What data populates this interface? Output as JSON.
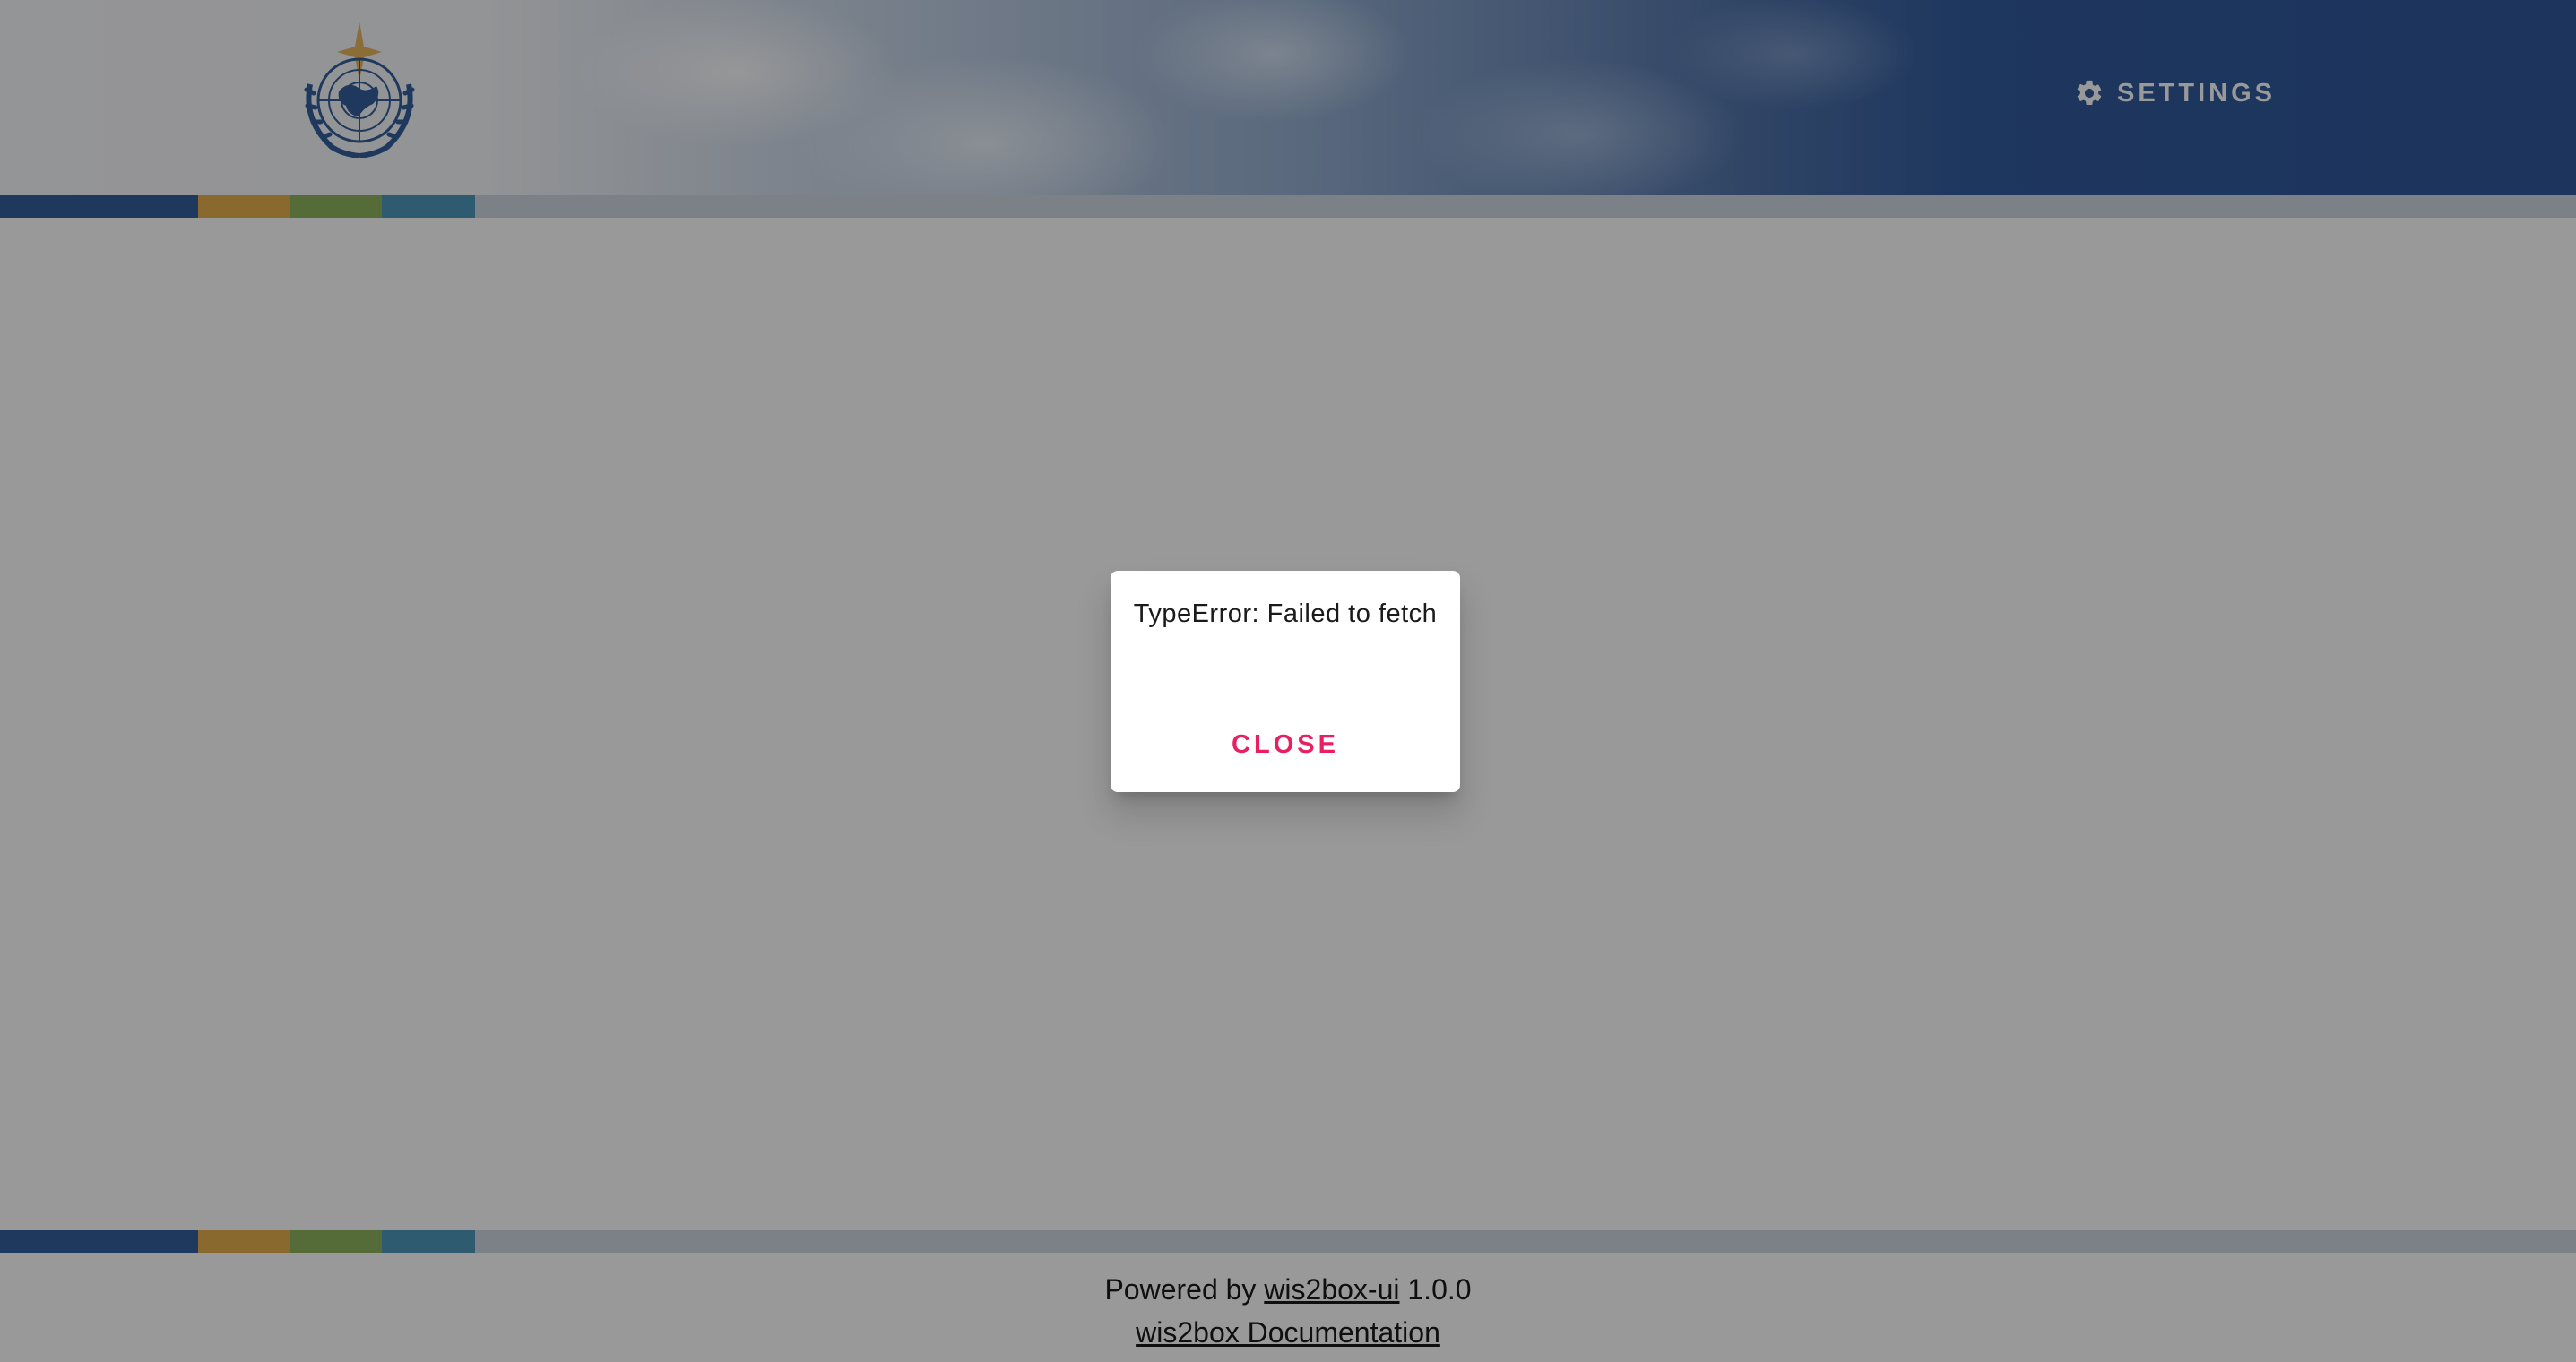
{
  "header": {
    "logo_icon": "wmo-emblem-icon",
    "settings_icon": "gear-icon",
    "settings_label": "SETTINGS"
  },
  "colors": {
    "header_dark": "#1a4590",
    "stripe_blue": "#1f4f93",
    "stripe_orange": "#e2a739",
    "stripe_green": "#84ad4c",
    "stripe_teal": "#3b8db5",
    "stripe_rest": "#c7d3de",
    "accent_close": "#e91e63",
    "overlay": "rgba(33,33,33,0.46)"
  },
  "dialog": {
    "message": "TypeError: Failed to fetch",
    "close_label": "CLOSE"
  },
  "footer": {
    "powered_prefix": "Powered by ",
    "powered_link": "wis2box-ui",
    "version": " 1.0.0",
    "docs_link": "wis2box Documentation"
  }
}
